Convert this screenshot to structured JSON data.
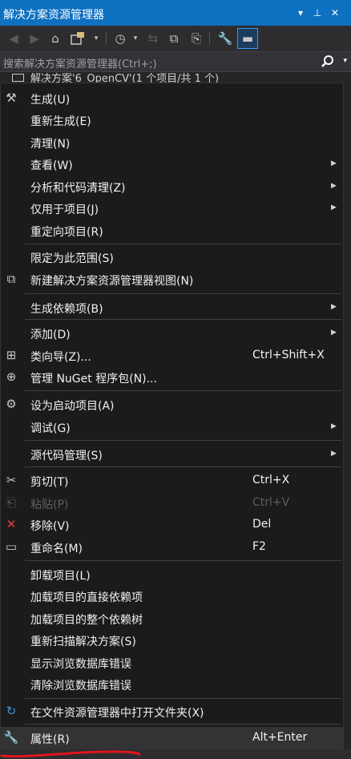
{
  "titlebar": {
    "title": "解决方案资源管理器",
    "dropdown_glyph": "▾",
    "pin_glyph": "⊥",
    "close_glyph": "✕"
  },
  "toolbar": {
    "back": "◀",
    "forward": "▶",
    "home": "⌂",
    "sync": "⇆",
    "dropdown": "▾",
    "history": "◷",
    "collapse": "⧉",
    "show_all": "⎘",
    "properties": "🔧",
    "preview": "▬"
  },
  "search": {
    "placeholder": "搜索解决方案资源管理器(Ctrl+;)",
    "icon": "search-icon",
    "dropdown_glyph": "▾"
  },
  "tree": {
    "partial_row": "解决方案'6_OpenCV'(1 个项目/共 1 个)"
  },
  "menu": [
    {
      "label": "生成(U)",
      "shortcut": "",
      "submenu": false,
      "icon": "build-icon",
      "glyph": "⚒",
      "disabled": false
    },
    {
      "label": "重新生成(E)",
      "shortcut": "",
      "submenu": false,
      "icon": "",
      "glyph": "",
      "disabled": false
    },
    {
      "label": "清理(N)",
      "shortcut": "",
      "submenu": false,
      "icon": "",
      "glyph": "",
      "disabled": false
    },
    {
      "label": "查看(W)",
      "shortcut": "",
      "submenu": true,
      "icon": "",
      "glyph": "",
      "disabled": false
    },
    {
      "label": "分析和代码清理(Z)",
      "shortcut": "",
      "submenu": true,
      "icon": "",
      "glyph": "",
      "disabled": false
    },
    {
      "label": "仅用于项目(J)",
      "shortcut": "",
      "submenu": true,
      "icon": "",
      "glyph": "",
      "disabled": false
    },
    {
      "label": "重定向项目(R)",
      "shortcut": "",
      "submenu": false,
      "icon": "",
      "glyph": "",
      "disabled": false
    },
    {
      "label": "限定为此范围(S)",
      "shortcut": "",
      "submenu": false,
      "icon": "",
      "glyph": "",
      "disabled": false
    },
    {
      "label": "新建解决方案资源管理器视图(N)",
      "shortcut": "",
      "submenu": false,
      "icon": "new-view-icon",
      "glyph": "⧉",
      "disabled": false
    },
    {
      "label": "生成依赖项(B)",
      "shortcut": "",
      "submenu": true,
      "icon": "",
      "glyph": "",
      "disabled": false
    },
    {
      "label": "添加(D)",
      "shortcut": "",
      "submenu": true,
      "icon": "",
      "glyph": "",
      "disabled": false
    },
    {
      "label": "类向导(Z)...",
      "shortcut": "Ctrl+Shift+X",
      "submenu": false,
      "icon": "class-wizard-icon",
      "glyph": "⊞",
      "disabled": false
    },
    {
      "label": "管理 NuGet 程序包(N)...",
      "shortcut": "",
      "submenu": false,
      "icon": "nuget-package-icon",
      "glyph": "⊕",
      "disabled": false
    },
    {
      "label": "设为启动项目(A)",
      "shortcut": "",
      "submenu": false,
      "icon": "gear-icon",
      "glyph": "⚙",
      "disabled": false
    },
    {
      "label": "调试(G)",
      "shortcut": "",
      "submenu": true,
      "icon": "",
      "glyph": "",
      "disabled": false
    },
    {
      "label": "源代码管理(S)",
      "shortcut": "",
      "submenu": true,
      "icon": "",
      "glyph": "",
      "disabled": false
    },
    {
      "label": "剪切(T)",
      "shortcut": "Ctrl+X",
      "submenu": false,
      "icon": "scissors-icon",
      "glyph": "✂",
      "disabled": false
    },
    {
      "label": "粘贴(P)",
      "shortcut": "Ctrl+V",
      "submenu": false,
      "icon": "clipboard-icon",
      "glyph": "⎗",
      "disabled": true
    },
    {
      "label": "移除(V)",
      "shortcut": "Del",
      "submenu": false,
      "icon": "remove-x-icon",
      "glyph": "✕",
      "disabled": false
    },
    {
      "label": "重命名(M)",
      "shortcut": "F2",
      "submenu": false,
      "icon": "rename-icon",
      "glyph": "▭",
      "disabled": false
    },
    {
      "label": "卸载项目(L)",
      "shortcut": "",
      "submenu": false,
      "icon": "",
      "glyph": "",
      "disabled": false
    },
    {
      "label": "加载项目的直接依赖项",
      "shortcut": "",
      "submenu": false,
      "icon": "",
      "glyph": "",
      "disabled": false
    },
    {
      "label": "加载项目的整个依赖树",
      "shortcut": "",
      "submenu": false,
      "icon": "",
      "glyph": "",
      "disabled": false
    },
    {
      "label": "重新扫描解决方案(S)",
      "shortcut": "",
      "submenu": false,
      "icon": "",
      "glyph": "",
      "disabled": false
    },
    {
      "label": "显示浏览数据库错误",
      "shortcut": "",
      "submenu": false,
      "icon": "",
      "glyph": "",
      "disabled": false
    },
    {
      "label": "清除浏览数据库错误",
      "shortcut": "",
      "submenu": false,
      "icon": "",
      "glyph": "",
      "disabled": false
    },
    {
      "label": "在文件资源管理器中打开文件夹(X)",
      "shortcut": "",
      "submenu": false,
      "icon": "open-folder-icon",
      "glyph": "↻",
      "disabled": false
    },
    {
      "label": "属性(R)",
      "shortcut": "Alt+Enter",
      "submenu": false,
      "icon": "wrench-icon",
      "glyph": "🔧",
      "disabled": false
    }
  ],
  "colors": {
    "title_bar": "#0e70c0",
    "menu_bg": "#1b1b1c",
    "text": "#f1f1f1",
    "disabled_text": "#5d5d5d",
    "remove_icon": "#e0443e",
    "open_folder_icon": "#3c9ad6",
    "annotation_stroke": "#e0141e"
  }
}
